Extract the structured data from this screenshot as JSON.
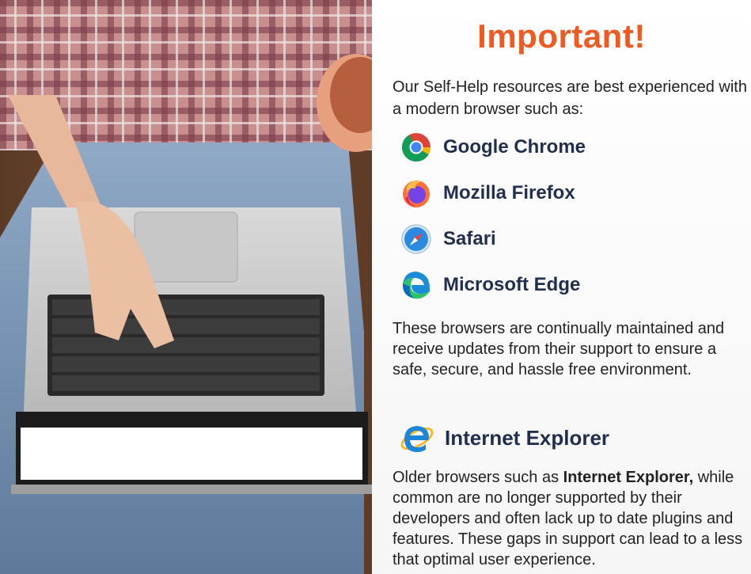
{
  "title": "Important!",
  "intro": "Our Self-Help resources are best experienced with a modern browser such as:",
  "browsers": [
    {
      "name": "Google Chrome",
      "icon": "chrome-icon"
    },
    {
      "name": "Mozilla Firefox",
      "icon": "firefox-icon"
    },
    {
      "name": "Safari",
      "icon": "safari-icon"
    },
    {
      "name": "Microsoft Edge",
      "icon": "edge-icon"
    }
  ],
  "maintained_text": "These browsers are continually maintained and receive updates from their support to ensure a safe, secure, and hassle free environment.",
  "legacy": {
    "name": "Internet Explorer",
    "icon": "internet-explorer-icon",
    "text_prefix": "Older browsers such as ",
    "text_bold": "Internet Explorer,",
    "text_suffix": " while common are no longer supported by their developers and often lack up to date plugins and features. These gaps in support can lead to a less that optimal user experience."
  },
  "colors": {
    "title": "#ee5b22",
    "browser_name": "#1f2f4d",
    "body_text": "#222222"
  }
}
